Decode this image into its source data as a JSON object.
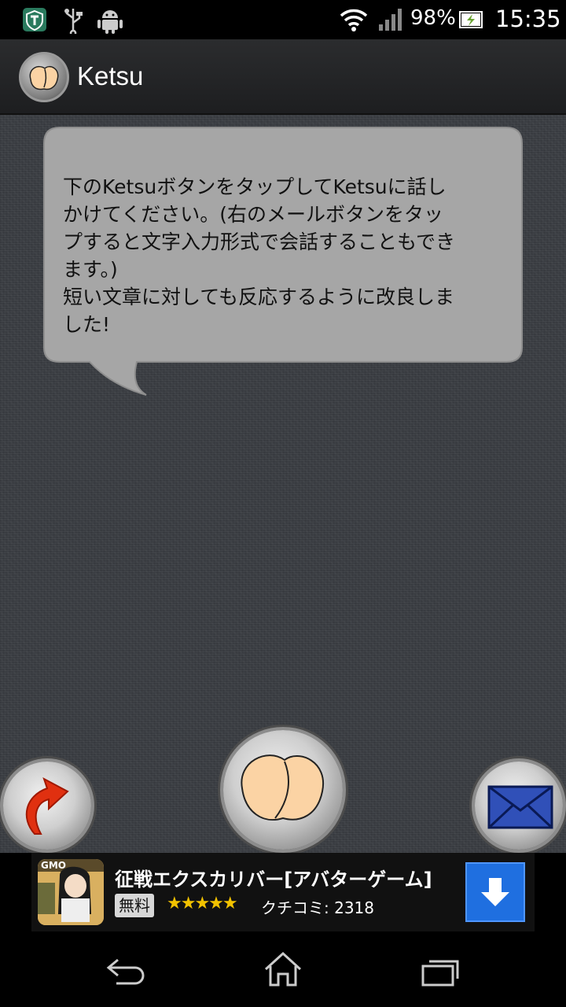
{
  "status_bar": {
    "battery_percent": "98%",
    "time": "15:35",
    "icons": [
      "shield-app-icon",
      "usb-icon",
      "android-debug-icon",
      "wifi-icon",
      "signal-icon",
      "battery-charging-icon"
    ]
  },
  "action_bar": {
    "title": "Ketsu",
    "icon": "ketsu-app-icon"
  },
  "bubble": {
    "text": "下のKetsuボタンをタップしてKetsuに話し\nかけてください。(右のメールボタンをタッ\nプすると文字入力形式で会話することもでき\nます。)\n短い文章に対しても反応するように改良しま\nした!"
  },
  "controls": {
    "back_button_icon": "curved-arrow-icon",
    "ketsu_button_icon": "ketsu-icon",
    "mail_button_icon": "envelope-icon"
  },
  "ad": {
    "title": "征戦エクスカリバー[アバターゲーム]",
    "price_label": "無料",
    "rating": 4.5,
    "stars_text": "★★★★★",
    "review_text": "クチコミ: 2318",
    "badge": "GMO",
    "download_icon": "download-arrow-icon"
  },
  "nav_bar": {
    "icons": [
      "back-icon",
      "home-icon",
      "recent-apps-icon"
    ]
  },
  "colors": {
    "background": "#3a3d42",
    "bubble": "#a6a6a6",
    "download_button": "#1f6fe0",
    "accent_red": "#e03010",
    "envelope_blue": "#3050b8"
  }
}
